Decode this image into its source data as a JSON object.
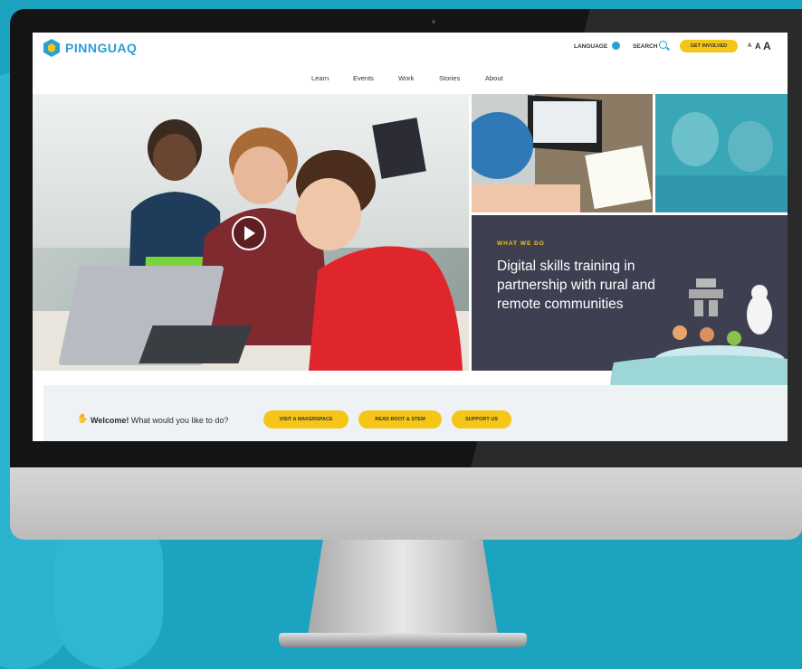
{
  "header": {
    "logo_text": "PINNGUAQ",
    "language_label": "LANGUAGE",
    "search_label": "SEARCH",
    "cta_label": "GET INVOLVED",
    "font_small": "A",
    "font_medium": "A",
    "font_large": "A"
  },
  "nav": {
    "items": [
      {
        "label": "Learn"
      },
      {
        "label": "Events"
      },
      {
        "label": "Work"
      },
      {
        "label": "Stories"
      },
      {
        "label": "About"
      }
    ]
  },
  "feature": {
    "eyebrow": "WHAT WE DO",
    "headline": "Digital skills training in partnership with rural and remote communities"
  },
  "welcome": {
    "hand_icon": "✋",
    "bold": "Welcome!",
    "text": " What would you like to do?",
    "buttons": [
      {
        "label": "VISIT A MAKERSPACE"
      },
      {
        "label": "READ ROOT & STEM"
      },
      {
        "label": "SUPPORT US"
      }
    ]
  },
  "colors": {
    "brand_blue": "#2a9fd6",
    "accent_yellow": "#f5c518",
    "panel_dark": "#3e4052",
    "background_teal": "#1ba3c0"
  }
}
